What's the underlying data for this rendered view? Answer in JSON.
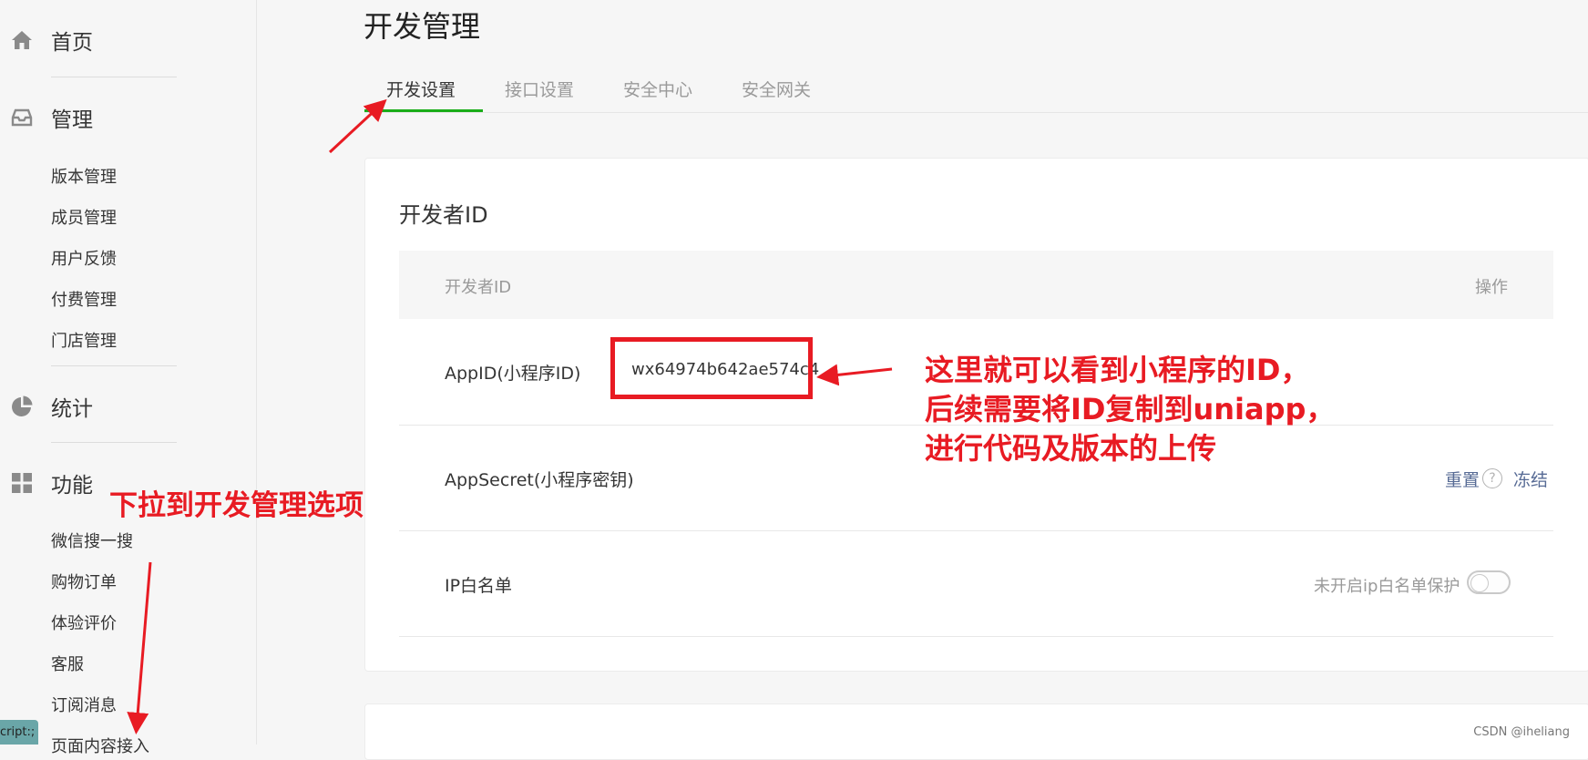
{
  "sidebar": {
    "sections": [
      {
        "label": "首页",
        "icon": "home-icon"
      },
      {
        "label": "管理",
        "icon": "inbox-icon"
      },
      {
        "label": "统计",
        "icon": "pie-chart-icon"
      },
      {
        "label": "功能",
        "icon": "grid-icon"
      }
    ],
    "manage_items": [
      "版本管理",
      "成员管理",
      "用户反馈",
      "付费管理",
      "门店管理"
    ],
    "feature_items": [
      "微信搜一搜",
      "购物订单",
      "体验评价",
      "客服",
      "订阅消息",
      "页面内容接入"
    ],
    "script_tag": "cript:;"
  },
  "page": {
    "title": "开发管理"
  },
  "tabs": [
    {
      "label": "开发设置",
      "active": true
    },
    {
      "label": "接口设置",
      "active": false
    },
    {
      "label": "安全中心",
      "active": false
    },
    {
      "label": "安全网关",
      "active": false
    }
  ],
  "developer_id": {
    "section_title": "开发者ID",
    "header": {
      "col1": "开发者ID",
      "col2": "操作"
    },
    "appid": {
      "label": "AppID(小程序ID)",
      "value": "wx64974b642ae574c4"
    },
    "appsecret": {
      "label": "AppSecret(小程序密钥)",
      "reset": "重置",
      "help": "?",
      "freeze": "冻结"
    },
    "ip_whitelist": {
      "label": "IP白名单",
      "status": "未开启ip白名单保护",
      "enabled": false
    }
  },
  "annotations": {
    "right": [
      "这里就可以看到小程序的ID，",
      "后续需要将ID复制到uniapp，",
      "进行代码及版本的上传"
    ],
    "left": "下拉到开发管理选项",
    "color": "#e81b23"
  },
  "watermark": "CSDN @iheliang",
  "colors": {
    "accent_green": "#1aad19",
    "link_blue": "#576b95"
  }
}
